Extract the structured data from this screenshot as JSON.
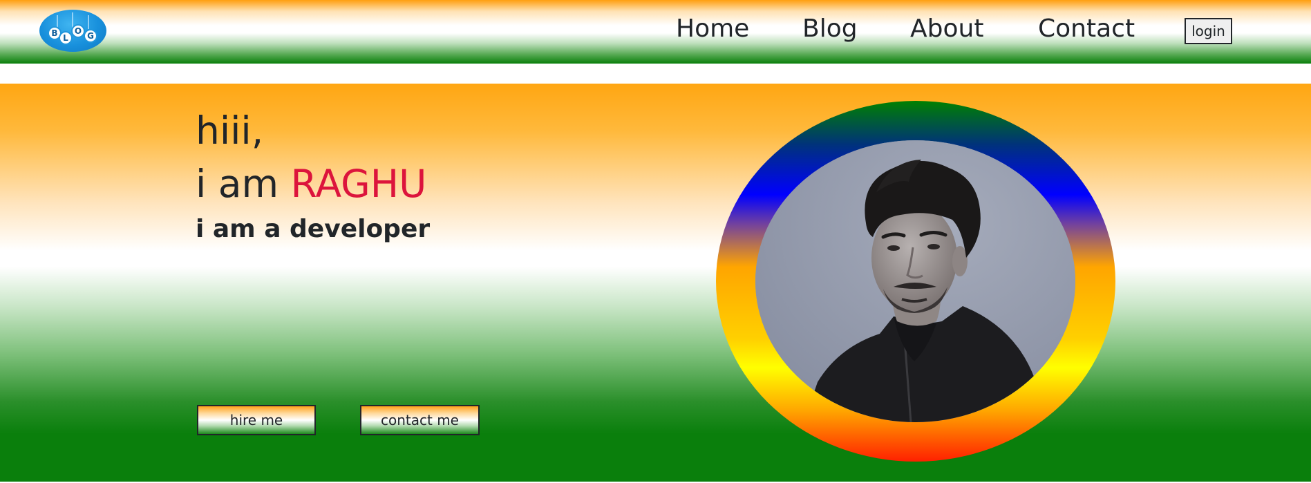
{
  "header": {
    "logo": {
      "letters": [
        "B",
        "L",
        "O",
        "G"
      ],
      "colors": {
        "bubble": "#1890dc",
        "letter_bg": "#ffffff",
        "letter_text": "#0e5e9a"
      }
    },
    "nav": [
      {
        "label": "Home"
      },
      {
        "label": "Blog"
      },
      {
        "label": "About"
      },
      {
        "label": "Contact"
      }
    ],
    "login_label": "login"
  },
  "hero": {
    "greeting": "hiii,",
    "intro_prefix": "i am ",
    "name": "RAGHU",
    "role": "i am a developer",
    "buttons": {
      "hire": "hire me",
      "contact": "contact me"
    },
    "profile_photo": {
      "subject": "portrait of a young man in a black jacket",
      "frame": "rainbow-gradient-ring"
    }
  },
  "colors": {
    "saffron": "#ffa612",
    "white": "#ffffff",
    "green": "#0a7f0c",
    "name_accent": "#dc143c",
    "text": "#212529"
  }
}
